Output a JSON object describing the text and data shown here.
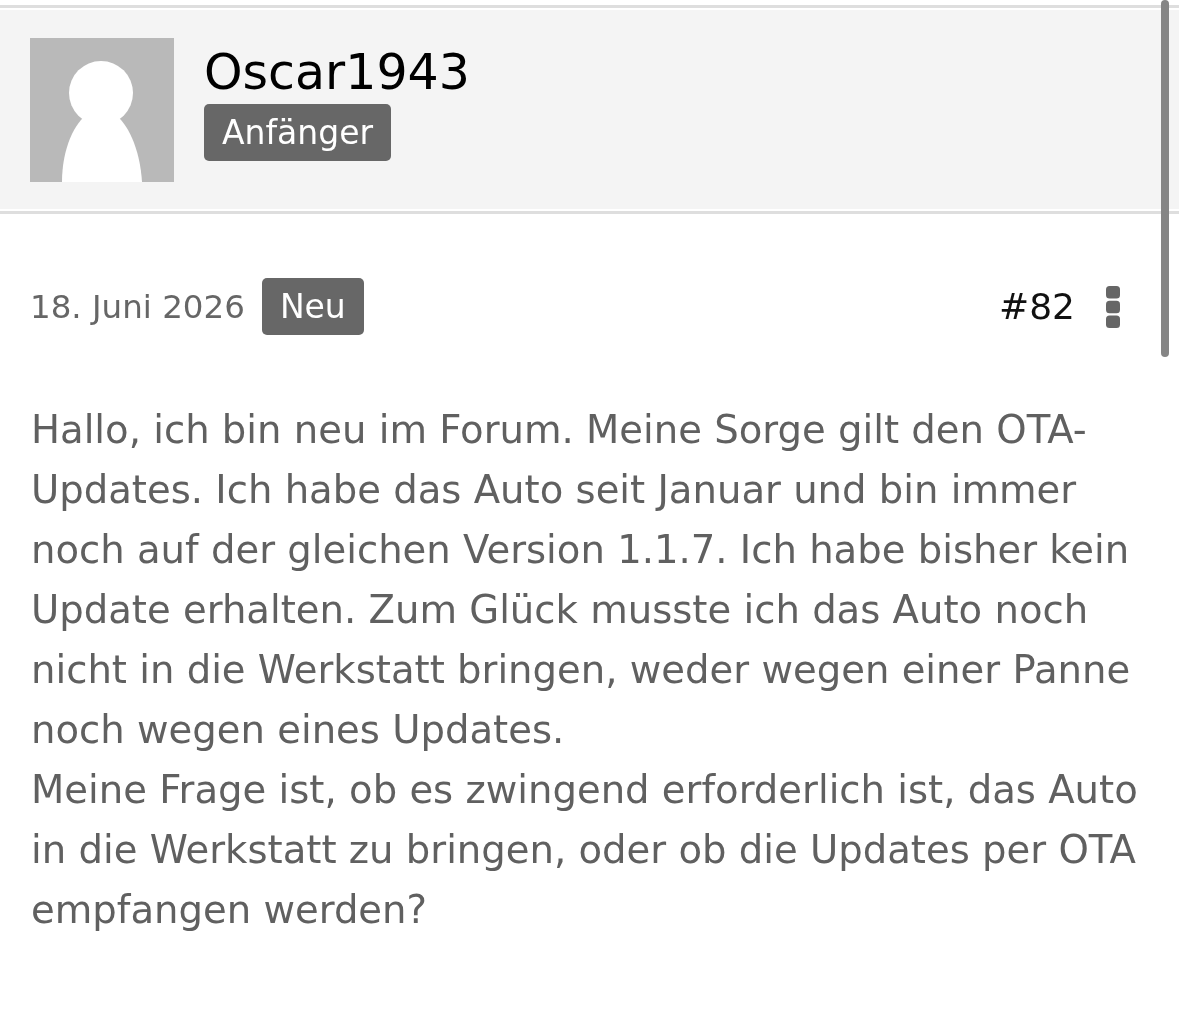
{
  "author": {
    "name": "Oscar1943",
    "rank": "Anfänger"
  },
  "post": {
    "date": "18. Juni 2026",
    "badge": "Neu",
    "number": "#82",
    "paragraphs": [
      "Hallo, ich bin neu im Forum. Meine Sorge gilt den OTA-Updates. Ich habe das Auto seit Januar und bin immer noch auf der gleichen Version 1.1.7. Ich habe bisher kein Update erhalten. Zum Glück musste ich das Auto noch nicht in die Werkstatt bringen, weder wegen einer Panne noch wegen eines Updates.",
      "Meine Frage ist, ob es zwingend erforderlich ist, das Auto in die Werkstatt zu bringen, oder ob die Updates per OTA empfangen werden?"
    ]
  }
}
